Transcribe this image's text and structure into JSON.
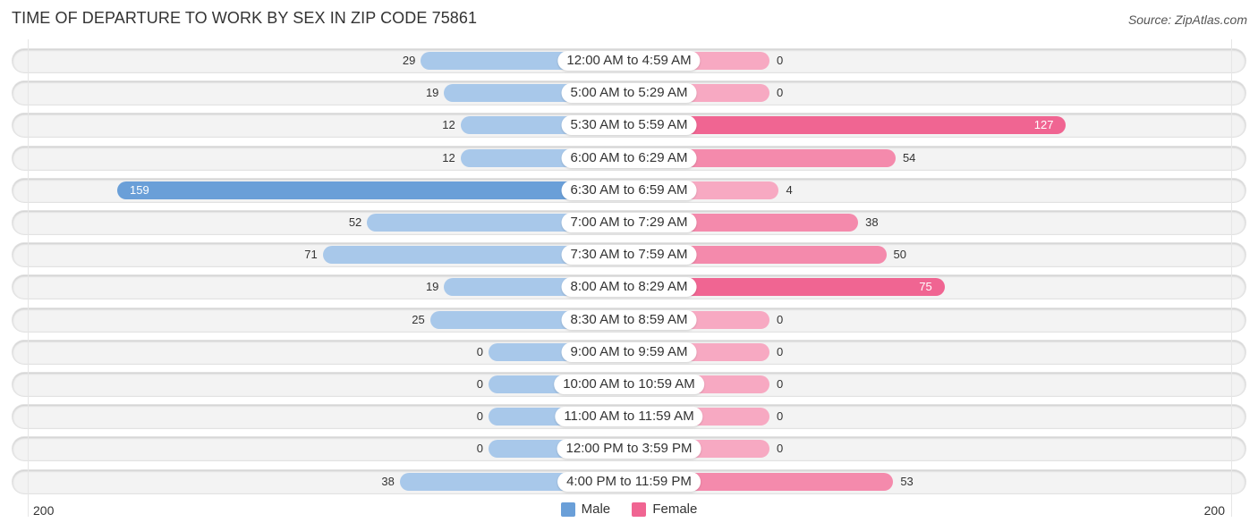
{
  "header": {
    "title": "TIME OF DEPARTURE TO WORK BY SEX IN ZIP CODE 75861",
    "source": "Source: ZipAtlas.com"
  },
  "colors": {
    "male": "#6a9fd8",
    "male_light": "#a8c8ea",
    "female": "#f06592",
    "female_light": "#f7a9c2"
  },
  "chart_data": {
    "type": "bar",
    "orientation": "horizontal-diverging",
    "title": "TIME OF DEPARTURE TO WORK BY SEX IN ZIP CODE 75861",
    "categories": [
      "12:00 AM to 4:59 AM",
      "5:00 AM to 5:29 AM",
      "5:30 AM to 5:59 AM",
      "6:00 AM to 6:29 AM",
      "6:30 AM to 6:59 AM",
      "7:00 AM to 7:29 AM",
      "7:30 AM to 7:59 AM",
      "8:00 AM to 8:29 AM",
      "8:30 AM to 8:59 AM",
      "9:00 AM to 9:59 AM",
      "10:00 AM to 10:59 AM",
      "11:00 AM to 11:59 AM",
      "12:00 PM to 3:59 PM",
      "4:00 PM to 11:59 PM"
    ],
    "series": [
      {
        "name": "Male",
        "values": [
          29,
          19,
          12,
          12,
          159,
          52,
          71,
          19,
          25,
          0,
          0,
          0,
          0,
          38
        ]
      },
      {
        "name": "Female",
        "values": [
          0,
          0,
          127,
          54,
          4,
          38,
          50,
          75,
          0,
          0,
          0,
          0,
          0,
          53
        ]
      }
    ],
    "axis": {
      "left_label": "200",
      "right_label": "200",
      "range": [
        0,
        200
      ]
    },
    "legend": {
      "position": "bottom-center",
      "entries": [
        "Male",
        "Female"
      ]
    },
    "grid": false
  }
}
